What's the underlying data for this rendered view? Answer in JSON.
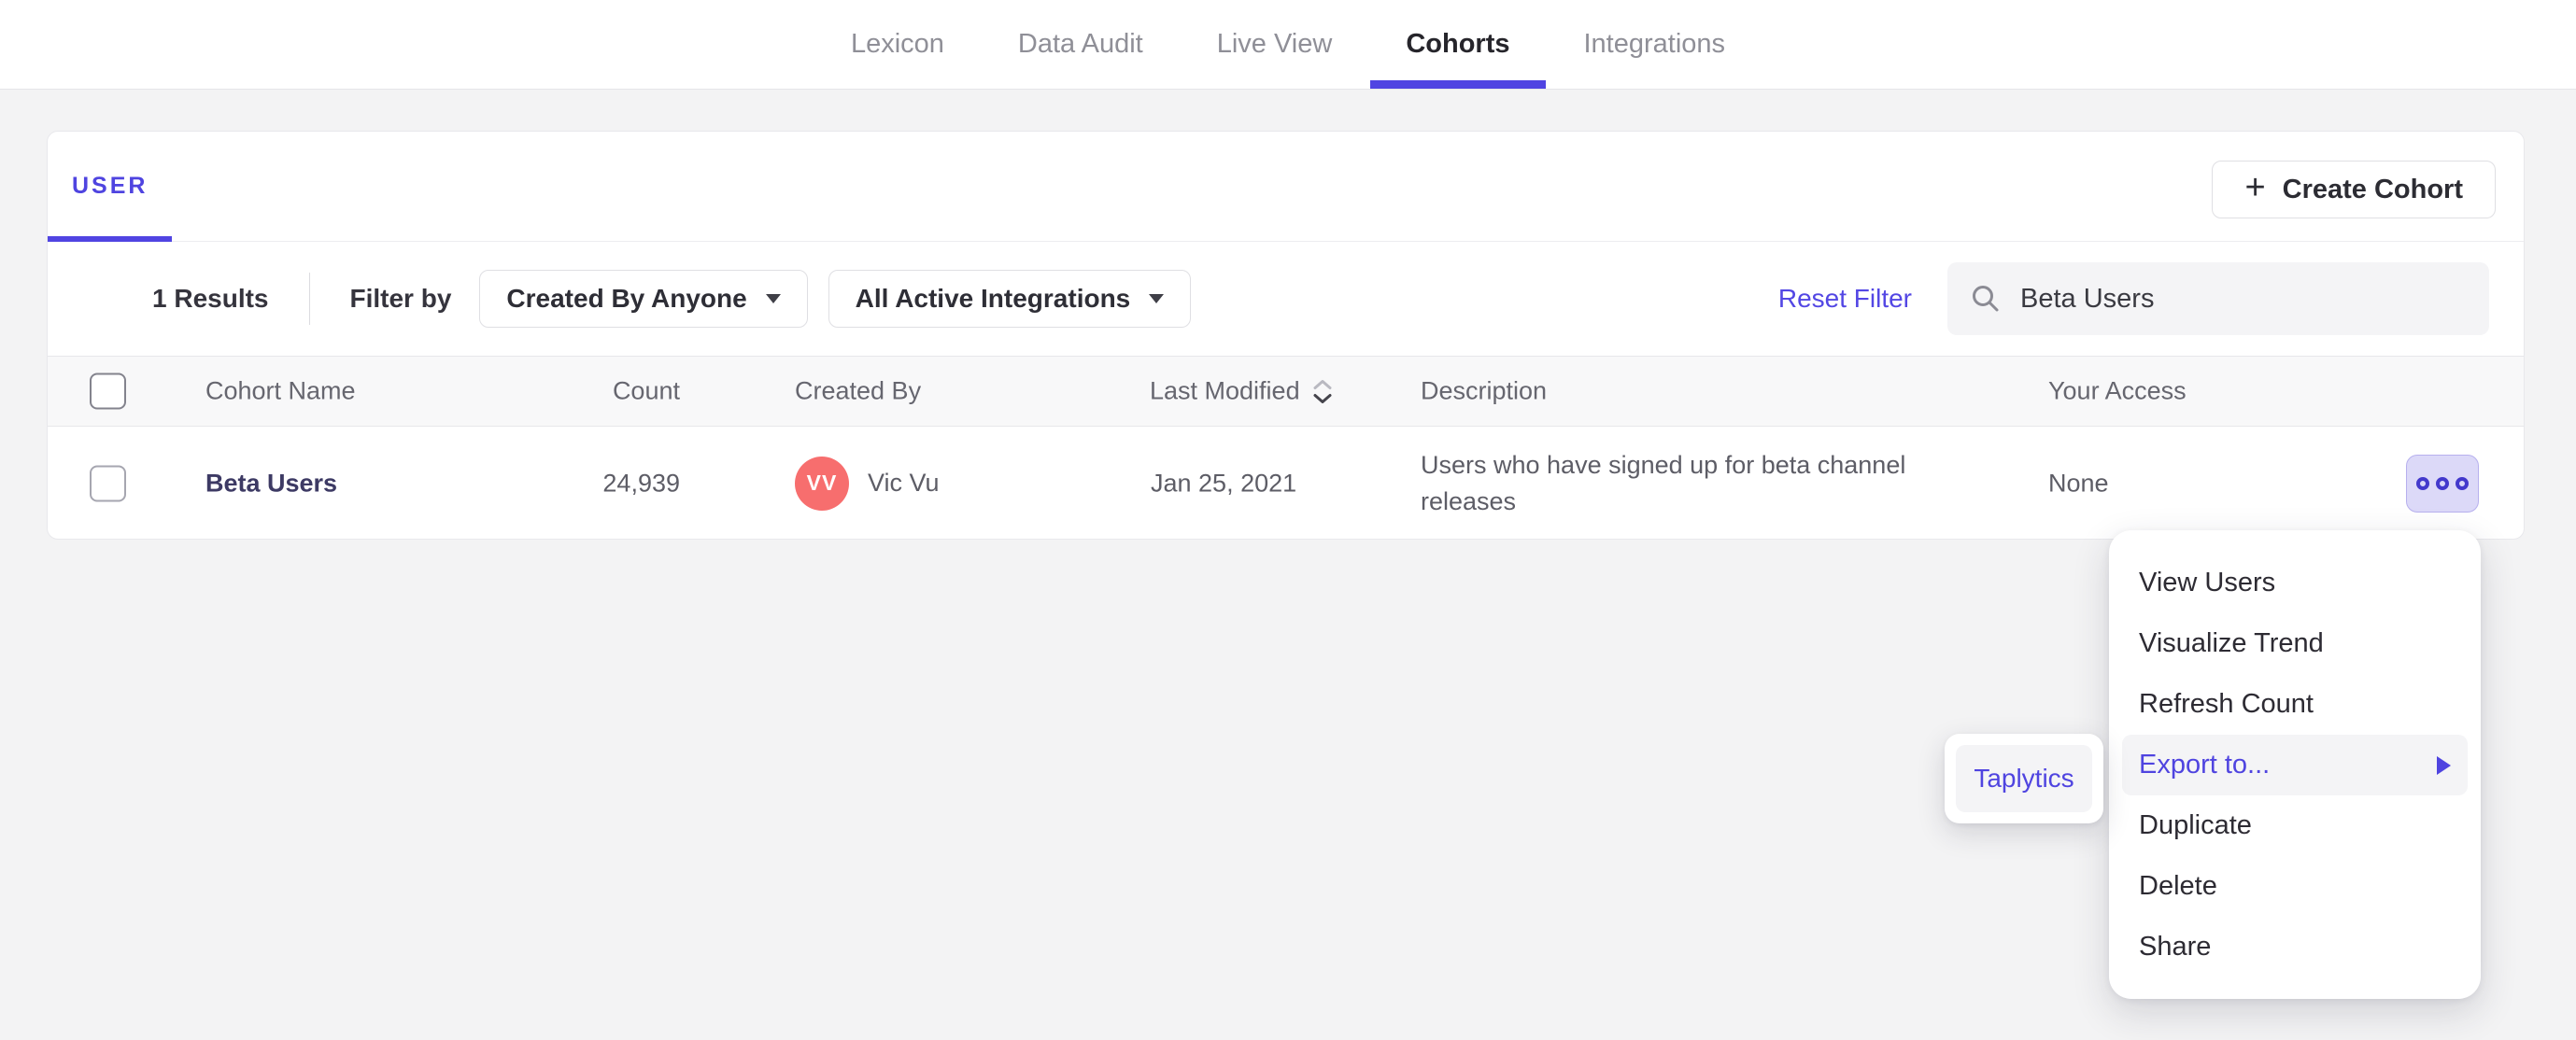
{
  "nav": {
    "tabs": [
      {
        "label": "Lexicon",
        "active": false
      },
      {
        "label": "Data Audit",
        "active": false
      },
      {
        "label": "Live View",
        "active": false
      },
      {
        "label": "Cohorts",
        "active": true
      },
      {
        "label": "Integrations",
        "active": false
      }
    ]
  },
  "panel": {
    "tab_label": "USER",
    "create_button": {
      "plus": "+",
      "label": "Create Cohort"
    },
    "filters": {
      "results": "1 Results",
      "filter_by": "Filter by",
      "created_by_dropdown": "Created By Anyone",
      "integrations_dropdown": "All Active Integrations",
      "reset": "Reset Filter",
      "search_value": "Beta Users"
    },
    "table": {
      "headers": {
        "name": "Cohort Name",
        "count": "Count",
        "created_by": "Created By",
        "last_modified": "Last Modified",
        "description": "Description",
        "access": "Your Access"
      },
      "row": {
        "name": "Beta Users",
        "count": "24,939",
        "avatar_initials": "VV",
        "created_by": "Vic Vu",
        "last_modified": "Jan 25, 2021",
        "description": "Users who have signed up for beta channel releases",
        "access": "None"
      }
    }
  },
  "menu": {
    "items": {
      "view_users": "View Users",
      "visualize_trend": "Visualize Trend",
      "refresh_count": "Refresh Count",
      "export_to": "Export to...",
      "duplicate": "Duplicate",
      "delete": "Delete",
      "share": "Share"
    },
    "highlighted_item": "Export to...",
    "submenu_item": "Taplytics"
  },
  "colors": {
    "accent_purple": "#4f44e0",
    "tab_underline": "#5044e2",
    "cohort_link": "#3d3a64",
    "avatar_coral": "#f76e6e",
    "more_button_bg": "#dcd9f8",
    "body_bg": "#f3f3f4",
    "header_row_bg": "#f8f8f9"
  }
}
